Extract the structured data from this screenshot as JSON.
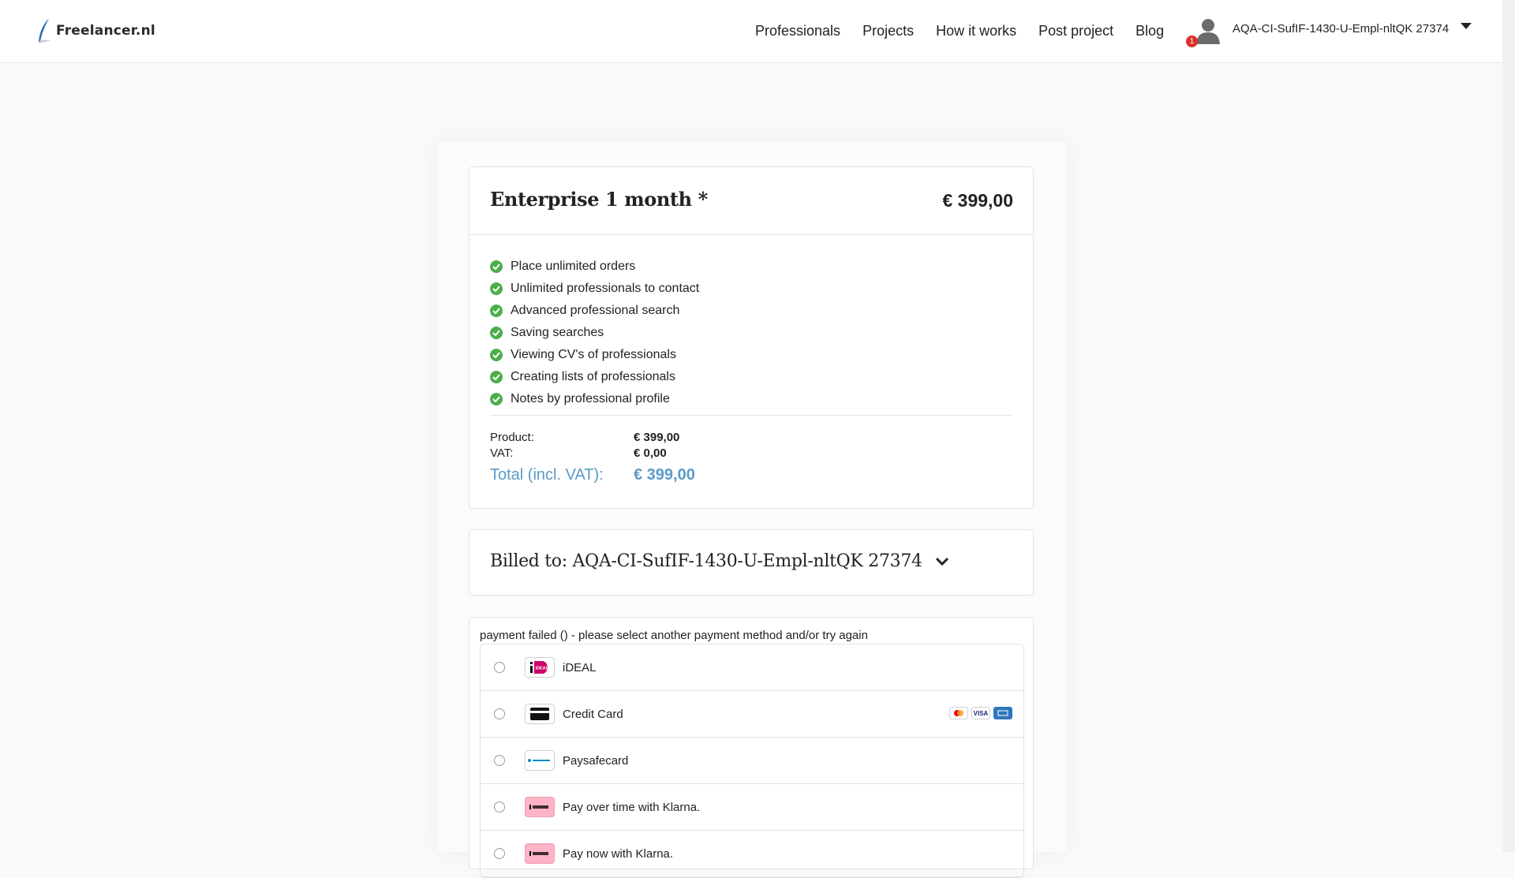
{
  "header": {
    "logo_text": "Freelancer.nl",
    "nav": [
      "Professionals",
      "Projects",
      "How it works",
      "Post project",
      "Blog"
    ],
    "user_name": "AQA-CI-SufIF-1430-U-Empl-nltQK 27374",
    "notification_count": "1"
  },
  "product": {
    "title": "Enterprise 1 month *",
    "price": "€ 399,00",
    "features": [
      "Place unlimited orders",
      "Unlimited professionals to contact",
      "Advanced professional search",
      "Saving searches",
      "Viewing CV's of professionals",
      "Creating lists of professionals",
      "Notes by professional profile"
    ],
    "summary": {
      "product_label": "Product:",
      "product_value": "€ 399,00",
      "vat_label": "VAT:",
      "vat_value": "€ 0,00",
      "total_label": "Total (incl. VAT):",
      "total_value": "€ 399,00"
    }
  },
  "billing": {
    "label": "Billed to: AQA-CI-SufIF-1430-U-Empl-nltQK 27374"
  },
  "payment": {
    "message": "payment failed () - please select another payment method and/or try again",
    "methods": [
      {
        "label": "iDEAL",
        "icon": "ideal-icon"
      },
      {
        "label": "Credit Card",
        "icon": "credit-card-icon"
      },
      {
        "label": "Paysafecard",
        "icon": "paysafecard-icon"
      },
      {
        "label": "Pay over time with Klarna.",
        "icon": "klarna-icon"
      },
      {
        "label": "Pay now with Klarna.",
        "icon": "klarna-icon"
      }
    ],
    "card_brands": [
      "mastercard",
      "visa",
      "amex"
    ]
  },
  "colors": {
    "check_green": "#4cae4c",
    "total_blue": "#5b9ac7",
    "badge_red": "#d9302c"
  }
}
